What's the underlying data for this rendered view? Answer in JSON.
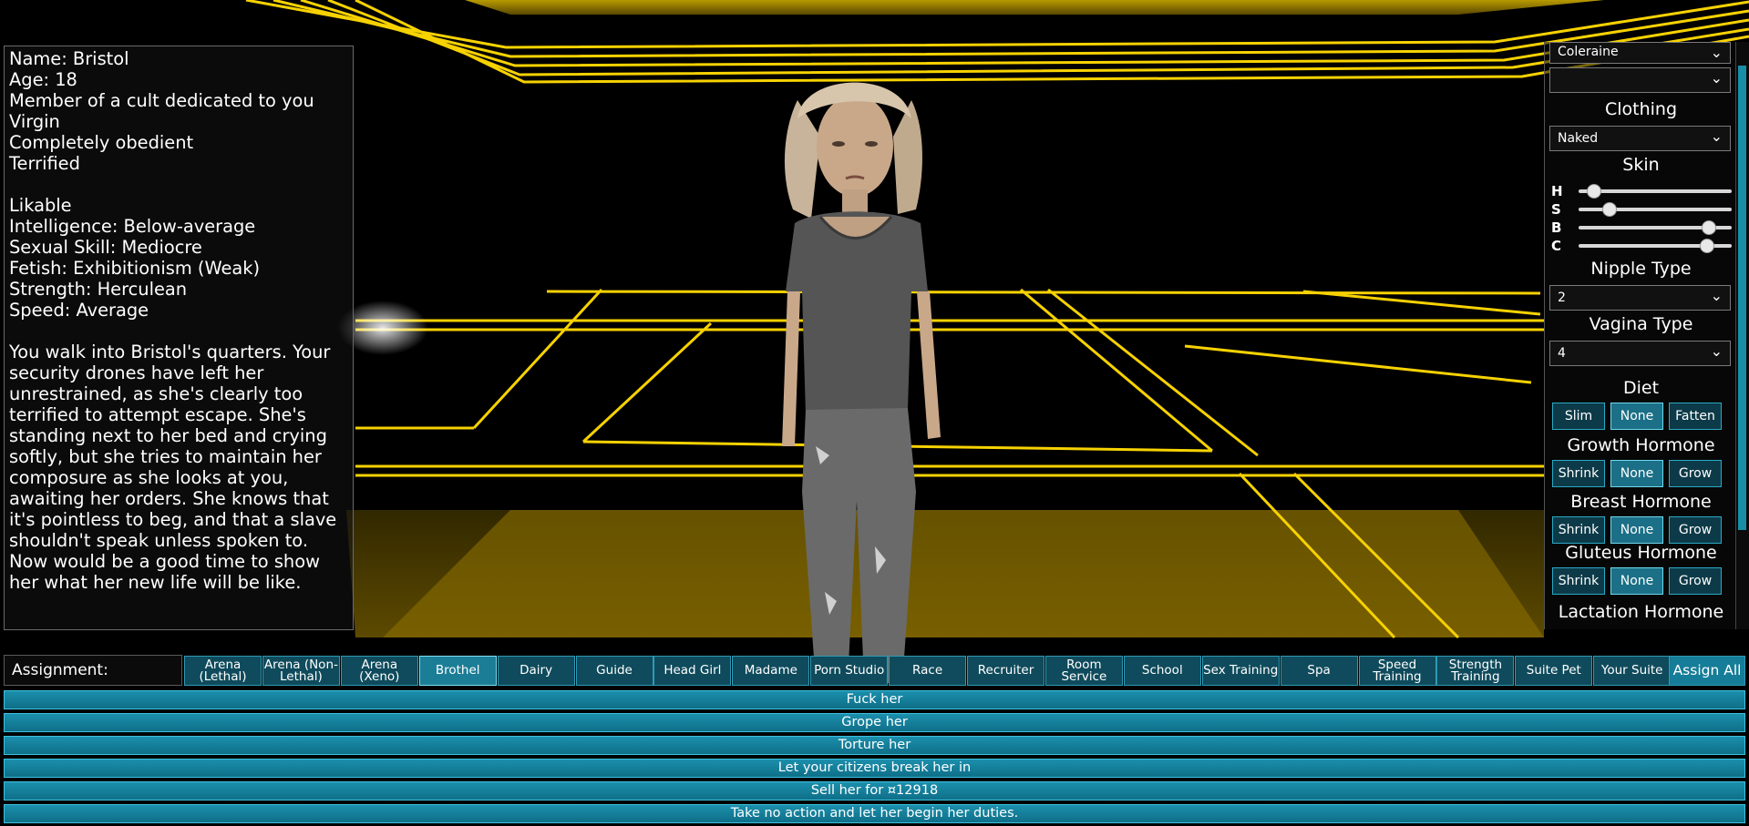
{
  "colors": {
    "grid_yellow": "#f7d200",
    "floor_yellow": "#7a6200",
    "button_teal": "#0f4b5c",
    "button_active": "#1c7d96",
    "action_teal": "#1b8fad"
  },
  "info": {
    "lines": [
      "Name: Bristol",
      "Age: 18",
      "Member of a cult dedicated to you",
      "Virgin",
      "Completely obedient",
      "Terrified",
      "",
      "Likable",
      "Intelligence: Below-average",
      "Sexual Skill: Mediocre",
      "Fetish: Exhibitionism (Weak)",
      "Strength: Herculean",
      "Speed: Average",
      ""
    ],
    "description": "You walk into Bristol's quarters. Your security drones have left her unrestrained, as she's clearly too terrified to attempt escape. She's standing next to her bed and crying softly, but she tries to maintain her composure as she looks at you, awaiting her orders. She knows that it's pointless to beg, and that a slave shouldn't speak unless spoken to. Now would be a good time to show her what her new life will be like."
  },
  "customize": {
    "location_value": "Coleraine",
    "second_value": "",
    "clothing_title": "Clothing",
    "clothing_value": "Naked",
    "skin_title": "Skin",
    "skin_sliders": [
      {
        "label": "H",
        "value": 0.1
      },
      {
        "label": "S",
        "value": 0.2
      },
      {
        "label": "B",
        "value": 0.85
      },
      {
        "label": "C",
        "value": 0.84
      }
    ],
    "nipple_title": "Nipple Type",
    "nipple_value": "2",
    "vagina_title": "Vagina Type",
    "vagina_value": "4",
    "diet_title": "Diet",
    "diet": [
      "Slim",
      "None",
      "Fatten"
    ],
    "growth_title": "Growth Hormone",
    "growth": [
      "Shrink",
      "None",
      "Grow"
    ],
    "breast_title": "Breast Hormone",
    "breast": [
      "Shrink",
      "None",
      "Grow"
    ],
    "gluteus_title": "Gluteus Hormone",
    "gluteus": [
      "Shrink",
      "None",
      "Grow"
    ],
    "lactation_title": "Lactation Hormone"
  },
  "assignment": {
    "label": "Assignment:",
    "options": [
      "Arena (Lethal)",
      "Arena (Non-Lethal)",
      "Arena (Xeno)",
      "Brothel",
      "Dairy",
      "Guide",
      "Head Girl",
      "Madame",
      "Porn Studio",
      "Race",
      "Recruiter",
      "Room Service",
      "School",
      "Sex Training",
      "Spa",
      "Speed Training",
      "Strength Training",
      "Suite Pet",
      "Your Suite"
    ],
    "selected": "Brothel",
    "assign_all": "Assign All"
  },
  "actions": [
    "Fuck her",
    "Grope her",
    "Torture her",
    "Let your citizens break her in",
    "Sell her for ¤12918",
    "Take no action and let her begin her duties."
  ]
}
